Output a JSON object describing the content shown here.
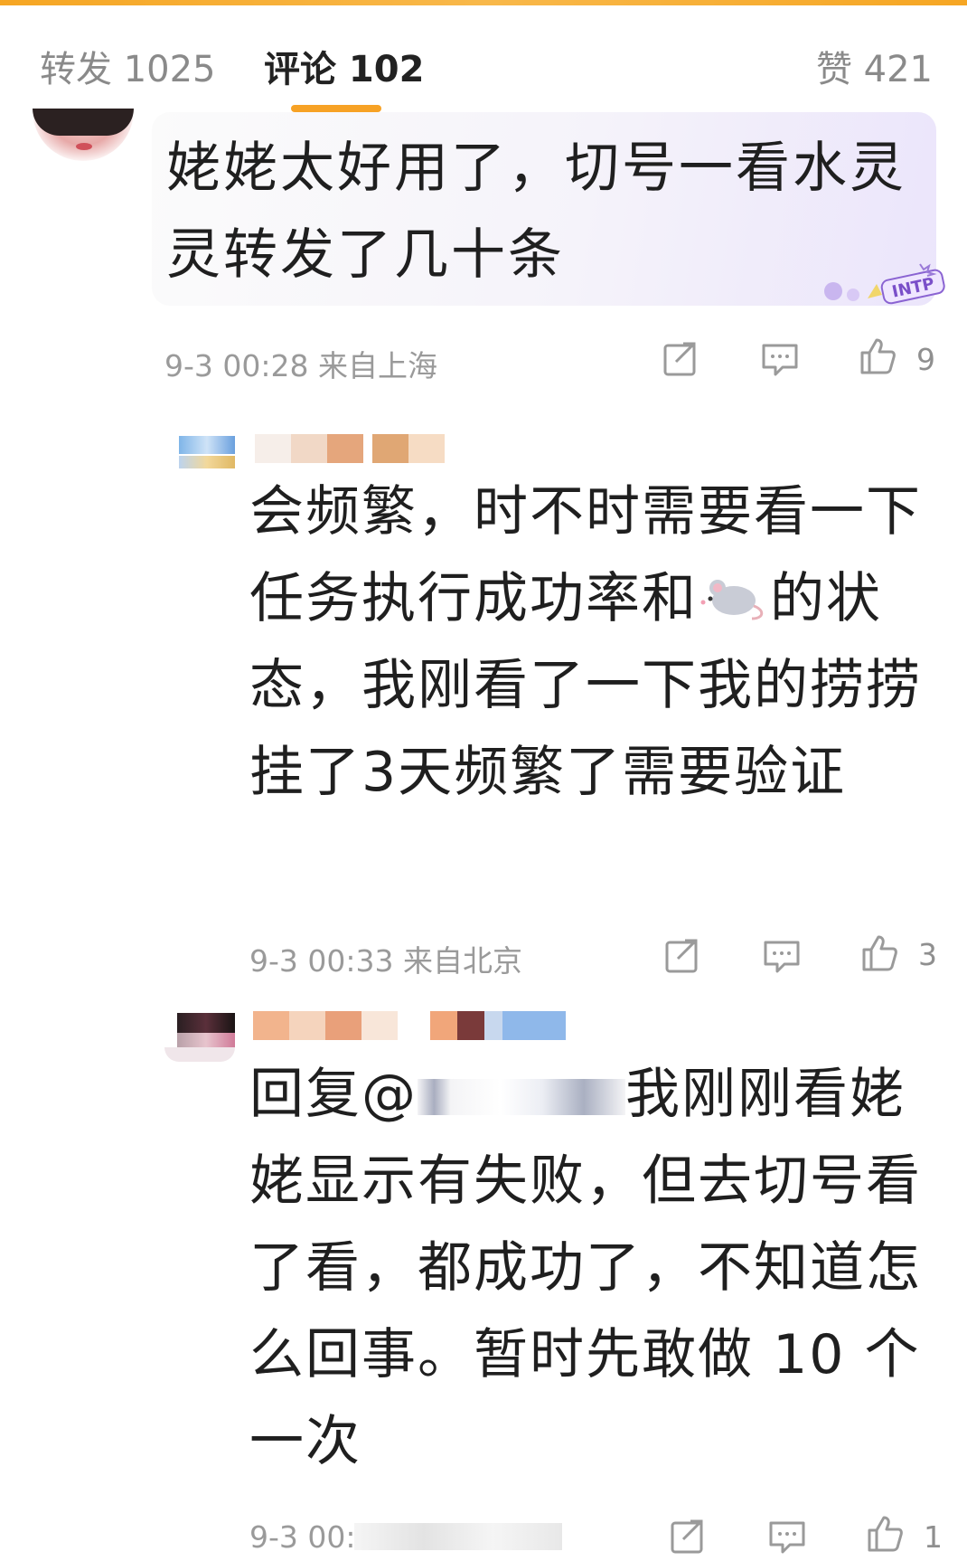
{
  "tabs": {
    "repost": "转发 1025",
    "comments": "评论 102",
    "likes": "赞 421"
  },
  "comment1": {
    "text": "姥姥太好用了，切号一看水灵灵转发了几十条",
    "badge": "INTP",
    "meta": "9-3 00:28 来自上海",
    "likes": "9"
  },
  "comment2": {
    "text_before_icon": "会频繁，时不时需要看一下任务执行成功率和",
    "icon": "mouse-emoji-icon",
    "text_after_icon": "的状态，我刚看了一下我的捞捞挂了3天频繁了需要验证",
    "meta": "9-3 00:33 来自北京",
    "likes": "3"
  },
  "comment3": {
    "reply_prefix": "回复@",
    "text": "我刚刚看姥姥显示有失败，但去切号看了看，都成功了，不知道怎么回事。暂时先敢做 10 个一次",
    "meta": "9-3 00:",
    "likes": "1"
  },
  "colors": {
    "accent": "#f7a225",
    "text_primary": "#1f1f1f",
    "text_secondary": "#9a9a9a"
  }
}
